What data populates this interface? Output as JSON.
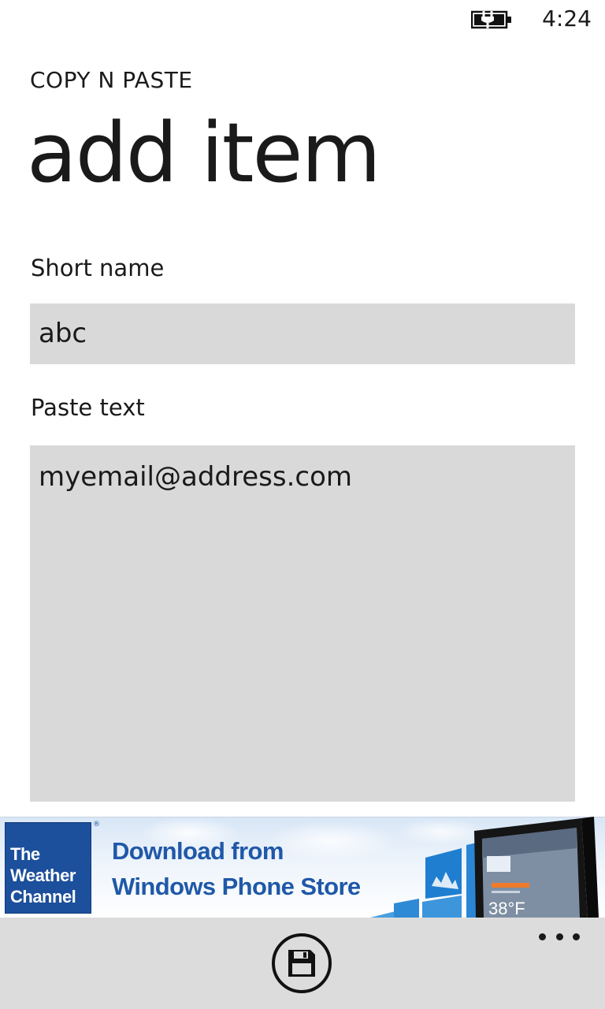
{
  "status_bar": {
    "time": "4:24",
    "battery_icon": "battery-charging-icon"
  },
  "header": {
    "app_title": "COPY N PASTE",
    "page_title": "add item"
  },
  "form": {
    "short_name_label": "Short name",
    "short_name_value": "abc",
    "paste_text_label": "Paste text",
    "paste_text_value": "myemail@address.com"
  },
  "ad": {
    "logo_line_1": "The",
    "logo_line_2": "Weather",
    "logo_line_3": "Channel",
    "registered_mark": "®",
    "headline_line_1": "Download from",
    "headline_line_2": "Windows Phone Store",
    "tablet_temperature": "38°F",
    "brand_color": "#1c4f9c"
  },
  "app_bar": {
    "save_icon": "save-icon",
    "more_icon": "more-icon"
  }
}
